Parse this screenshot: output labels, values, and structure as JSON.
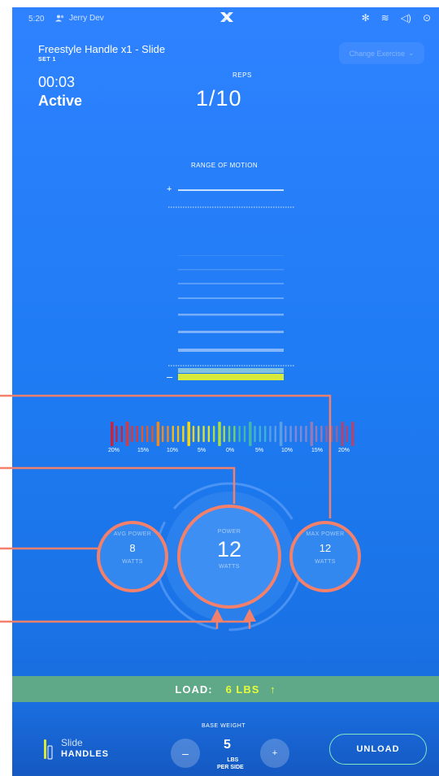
{
  "status_bar": {
    "time": "5:20",
    "user": "Jerry Dev",
    "logo": "X",
    "icons": [
      "bluetooth-icon",
      "wifi-icon",
      "volume-icon",
      "chevron-circle-icon"
    ]
  },
  "workout": {
    "title": "Freestyle Handle x1 - Slide",
    "set": "SET 1",
    "change_button": "Change Exercise",
    "timer": "00:03",
    "status": "Active",
    "reps_label": "REPS",
    "reps_value": "1/10"
  },
  "range_of_motion": {
    "label": "RANGE OF MOTION",
    "plus": "+",
    "minus": "–"
  },
  "balance_meter": {
    "tick_labels": [
      "20%",
      "15%",
      "10%",
      "5%",
      "0%",
      "5%",
      "10%",
      "15%",
      "20%"
    ]
  },
  "power": {
    "avg": {
      "label": "AVG POWER",
      "value": "8",
      "unit": "WATTS"
    },
    "current": {
      "label": "POWER",
      "value": "12",
      "unit": "WATTS"
    },
    "max": {
      "label": "MAX POWER",
      "value": "12",
      "unit": "WATTS"
    }
  },
  "load": {
    "label": "LOAD:",
    "value": "6 LBS",
    "arrow": "↑"
  },
  "bottom": {
    "accessory_name": "Slide",
    "accessory_type": "HANDLES",
    "base_weight_label": "BASE WEIGHT",
    "decrement": "–",
    "increment": "+",
    "base_weight_value": "5",
    "unit_line1": "LBS",
    "unit_line2": "PER SIDE",
    "unload_button": "UNLOAD"
  },
  "colors": {
    "background": "#2f82ff",
    "annotation": "#f2806b",
    "load_bar": "#5fa888",
    "load_value": "#e6ff3a",
    "rom_highlight": "#d7ea3a"
  }
}
